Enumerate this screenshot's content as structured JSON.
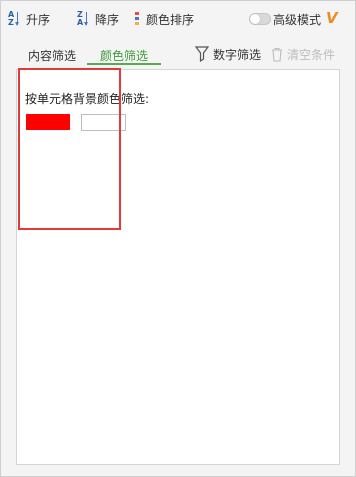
{
  "toolbar": {
    "sort_asc_label": "升序",
    "sort_desc_label": "降序",
    "color_sort_label": "颜色排序",
    "advanced_mode_label": "高级模式",
    "vip_mark": "V"
  },
  "tabs": [
    {
      "label": "内容筛选",
      "active": false
    },
    {
      "label": "颜色筛选",
      "active": true
    }
  ],
  "actions": {
    "number_filter_label": "数字筛选",
    "clear_label": "清空条件"
  },
  "color_filter": {
    "title": "按单元格背景颜色筛选:",
    "swatches": [
      {
        "name": "red",
        "color": "#ff0000"
      },
      {
        "name": "white",
        "color": "#ffffff"
      }
    ]
  },
  "colors": {
    "accent_green": "#3d9a39",
    "highlight_red": "#e03a3a",
    "vip_orange": "#f08a24"
  }
}
